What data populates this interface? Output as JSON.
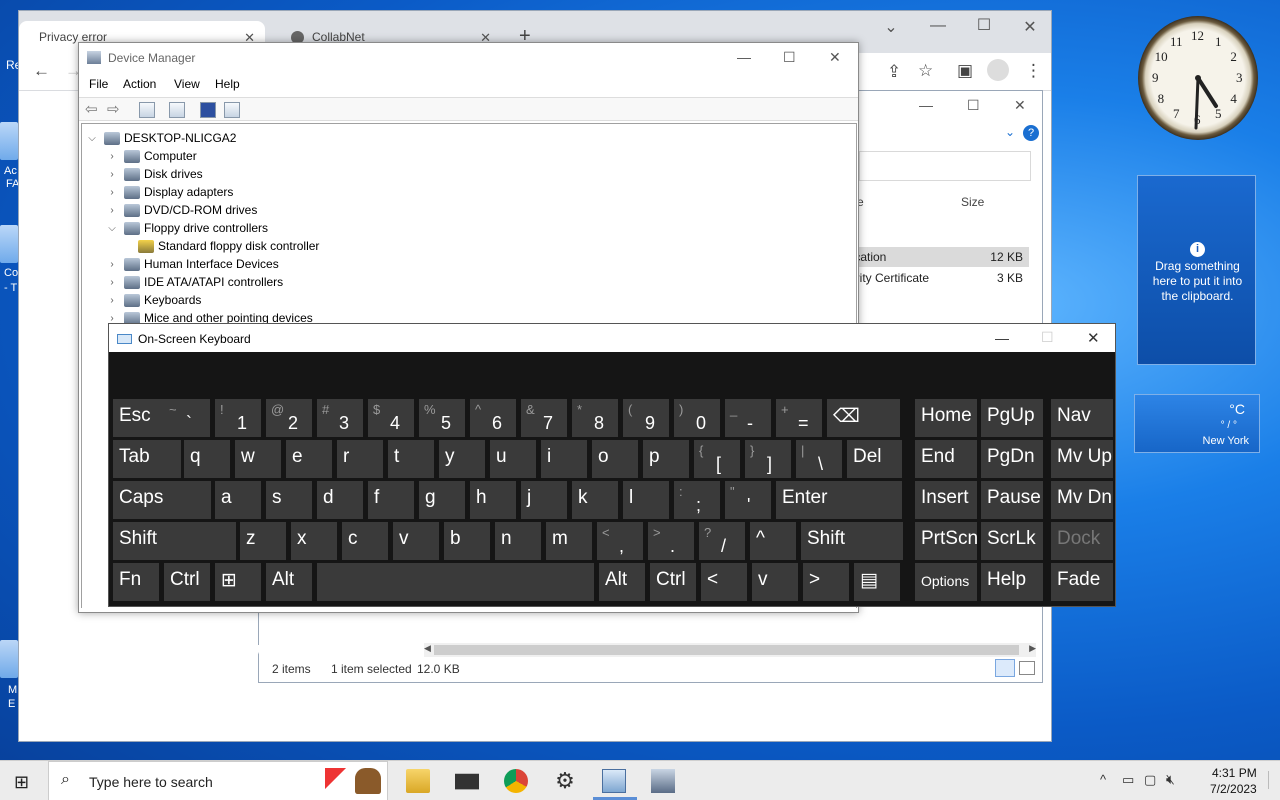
{
  "desktop": {
    "edge_fragments": [
      "Re",
      "Ac",
      "FA",
      "Co",
      "- T",
      "M",
      "E"
    ]
  },
  "chrome": {
    "tabs": [
      {
        "title": "Privacy error",
        "active": true
      },
      {
        "title": "CollabNet",
        "active": false
      }
    ],
    "new_tab_glyph": "+",
    "controls": {
      "minimize": "—",
      "maximize": "☐",
      "close": "✕",
      "dropdown": "⌄"
    }
  },
  "explorer": {
    "columns": {
      "name_fragment": "e",
      "size": "Size"
    },
    "rows": [
      {
        "name": "lication",
        "size": "12 KB",
        "selected": true
      },
      {
        "name": "urity Certificate",
        "size": "3 KB",
        "selected": false
      }
    ],
    "status": {
      "items": "2 items",
      "selected": "1 item selected",
      "size": "12.0 KB"
    }
  },
  "device_manager": {
    "title": "Device Manager",
    "menu": [
      "File",
      "Action",
      "View",
      "Help"
    ],
    "tree": [
      {
        "label": "DESKTOP-NLICGA2",
        "level": 0,
        "expanded": true
      },
      {
        "label": "Computer",
        "level": 1,
        "expanded": false
      },
      {
        "label": "Disk drives",
        "level": 1,
        "expanded": false
      },
      {
        "label": "Display adapters",
        "level": 1,
        "expanded": false
      },
      {
        "label": "DVD/CD-ROM drives",
        "level": 1,
        "expanded": false
      },
      {
        "label": "Floppy drive controllers",
        "level": 1,
        "expanded": true
      },
      {
        "label": "Standard floppy disk controller",
        "level": 2,
        "expanded": null
      },
      {
        "label": "Human Interface Devices",
        "level": 1,
        "expanded": false
      },
      {
        "label": "IDE ATA/ATAPI controllers",
        "level": 1,
        "expanded": false
      },
      {
        "label": "Keyboards",
        "level": 1,
        "expanded": false
      },
      {
        "label": "Mice and other pointing devices",
        "level": 1,
        "expanded": false
      }
    ]
  },
  "osk": {
    "title": "On-Screen Keyboard",
    "rows": [
      [
        {
          "l": "Esc"
        },
        {
          "s": "~",
          "m": "`"
        },
        {
          "s": "!",
          "m": "1"
        },
        {
          "s": "@",
          "m": "2"
        },
        {
          "s": "#",
          "m": "3"
        },
        {
          "s": "$",
          "m": "4"
        },
        {
          "s": "%",
          "m": "5"
        },
        {
          "s": "^",
          "m": "6"
        },
        {
          "s": "&",
          "m": "7"
        },
        {
          "s": "*",
          "m": "8"
        },
        {
          "s": "(",
          "m": "9"
        },
        {
          "s": ")",
          "m": "0"
        },
        {
          "s": "_",
          "m": "-"
        },
        {
          "s": "+",
          "m": "="
        },
        {
          "l": "⌫"
        },
        {
          "l": "Home"
        },
        {
          "l": "PgUp"
        },
        {
          "l": "Nav"
        }
      ],
      [
        {
          "l": "Tab"
        },
        {
          "l": "q"
        },
        {
          "l": "w"
        },
        {
          "l": "e"
        },
        {
          "l": "r"
        },
        {
          "l": "t"
        },
        {
          "l": "y"
        },
        {
          "l": "u"
        },
        {
          "l": "i"
        },
        {
          "l": "o"
        },
        {
          "l": "p"
        },
        {
          "s": "{",
          "m": "["
        },
        {
          "s": "}",
          "m": "]"
        },
        {
          "s": "|",
          "m": "\\"
        },
        {
          "l": "Del"
        },
        {
          "l": "End"
        },
        {
          "l": "PgDn"
        },
        {
          "l": "Mv Up"
        }
      ],
      [
        {
          "l": "Caps"
        },
        {
          "l": "a"
        },
        {
          "l": "s"
        },
        {
          "l": "d"
        },
        {
          "l": "f"
        },
        {
          "l": "g"
        },
        {
          "l": "h"
        },
        {
          "l": "j"
        },
        {
          "l": "k"
        },
        {
          "l": "l"
        },
        {
          "s": ":",
          "m": ";"
        },
        {
          "s": "\"",
          "m": "'"
        },
        {
          "l": "Enter"
        },
        {
          "l": "Insert"
        },
        {
          "l": "Pause"
        },
        {
          "l": "Mv Dn"
        }
      ],
      [
        {
          "l": "Shift"
        },
        {
          "l": "z"
        },
        {
          "l": "x"
        },
        {
          "l": "c"
        },
        {
          "l": "v"
        },
        {
          "l": "b"
        },
        {
          "l": "n"
        },
        {
          "l": "m"
        },
        {
          "s": "<",
          "m": ","
        },
        {
          "s": ">",
          "m": "."
        },
        {
          "s": "?",
          "m": "/"
        },
        {
          "l": "^"
        },
        {
          "l": "Shift"
        },
        {
          "l": "PrtScn"
        },
        {
          "l": "ScrLk"
        },
        {
          "l": "Dock",
          "dim": true
        }
      ],
      [
        {
          "l": "Fn"
        },
        {
          "l": "Ctrl"
        },
        {
          "l": "⊞"
        },
        {
          "l": "Alt"
        },
        {
          "l": ""
        },
        {
          "l": "Alt"
        },
        {
          "l": "Ctrl"
        },
        {
          "l": "<"
        },
        {
          "l": "v"
        },
        {
          "l": ">"
        },
        {
          "l": "▤"
        },
        {
          "l": "Options",
          "small": true
        },
        {
          "l": "Help"
        },
        {
          "l": "Fade"
        }
      ]
    ]
  },
  "gadgets": {
    "clock_numbers": [
      "12",
      "1",
      "2",
      "3",
      "4",
      "5",
      "6",
      "7",
      "8",
      "9",
      "10",
      "11"
    ],
    "clipboard_text": "Drag something here to put it into the clipboard.",
    "weather": {
      "unit": "°C",
      "range": "° / °",
      "city": "New York"
    }
  },
  "taskbar": {
    "search_placeholder": "Type here to search",
    "time": "4:31 PM",
    "date": "7/2/2023"
  }
}
